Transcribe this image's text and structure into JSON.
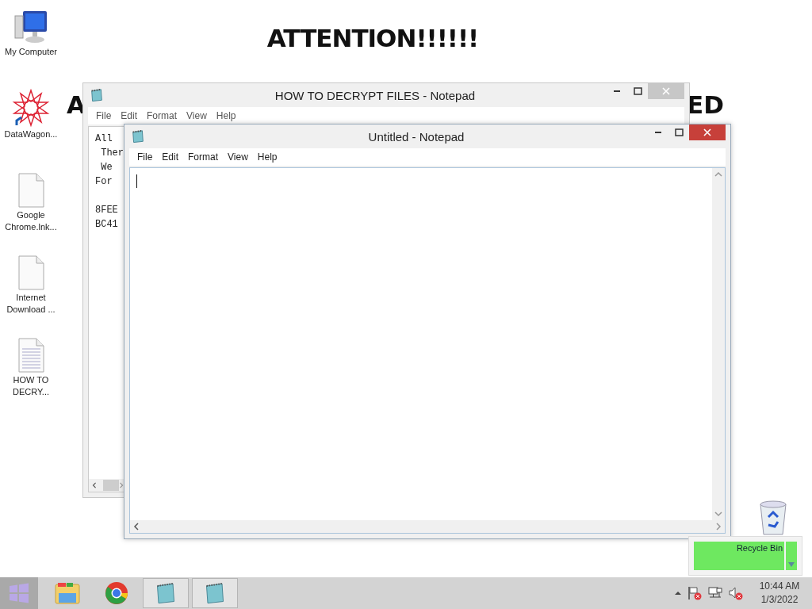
{
  "wallpaper": {
    "heading": "ATTENTION!!!!!!",
    "fragments": [
      "A",
      "ED"
    ]
  },
  "desktop_icons": [
    {
      "label": "My Computer",
      "kind": "computer"
    },
    {
      "label": "DataWagon...",
      "kind": "shortcut"
    },
    {
      "label": "Google Chrome.lnk...",
      "kind": "blank"
    },
    {
      "label": "Internet Download ...",
      "kind": "blank"
    },
    {
      "label": "HOW TO DECRY...",
      "kind": "text"
    },
    {
      "kind": "recycle"
    }
  ],
  "windows": [
    {
      "title": "HOW TO DECRYPT FILES - Notepad",
      "active": false,
      "menu": [
        "File",
        "Edit",
        "Format",
        "View",
        "Help"
      ],
      "lines": [
        "All",
        " Ther",
        " We",
        "For"
      ],
      "codes": [
        "8FEE",
        "BC41"
      ],
      "caret": false
    },
    {
      "title": "Untitled - Notepad",
      "active": true,
      "menu": [
        "File",
        "Edit",
        "Format",
        "View",
        "Help"
      ],
      "caret": true
    }
  ],
  "notification": {
    "label": "Recycle Bin"
  },
  "taskbar": {
    "buttons": [
      {
        "kind": "start",
        "running": false
      },
      {
        "kind": "folder",
        "running": false
      },
      {
        "kind": "browser",
        "running": false
      },
      {
        "kind": "notepad",
        "running": true
      },
      {
        "kind": "notepad",
        "running": true
      }
    ],
    "tray": {
      "icons": [
        {
          "kind": "chevron"
        },
        {
          "kind": "flag"
        },
        {
          "kind": "network"
        },
        {
          "kind": "speaker"
        }
      ],
      "time": "10:44 AM",
      "date": "1/3/2022"
    }
  }
}
